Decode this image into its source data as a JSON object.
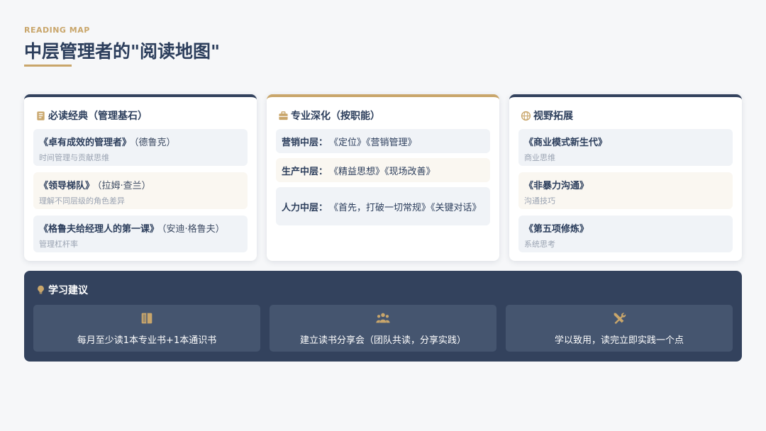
{
  "header": {
    "eyebrow": "READING MAP",
    "title": "中层管理者的\"阅读地图\""
  },
  "cards": [
    {
      "title": "必读经典（管理基石）",
      "icon": "book-icon",
      "items": [
        {
          "book": "《卓有成效的管理者》",
          "author": "（德鲁克）",
          "note": "时间管理与贡献思维"
        },
        {
          "book": "《领导梯队》",
          "author": "（拉姆·查兰）",
          "note": "理解不同层级的角色差异"
        },
        {
          "book": "《格鲁夫给经理人的第一课》",
          "author": "（安迪·格鲁夫）",
          "note": "管理杠杆率"
        }
      ]
    },
    {
      "title": "专业深化（按职能）",
      "icon": "briefcase-icon",
      "items": [
        {
          "role": "营销中层：",
          "books": "《定位》《营销管理》"
        },
        {
          "role": "生产中层：",
          "books": "《精益思想》《现场改善》"
        },
        {
          "role": "人力中层：",
          "books": "《首先，打破一切常规》《关键对话》"
        }
      ]
    },
    {
      "title": "视野拓展",
      "icon": "globe-icon",
      "items": [
        {
          "book": "《商业模式新生代》",
          "note": "商业思维"
        },
        {
          "book": "《非暴力沟通》",
          "note": "沟通技巧"
        },
        {
          "book": "《第五项修炼》",
          "note": "系统思考"
        }
      ]
    }
  ],
  "advice": {
    "title": "学习建议",
    "icon": "lightbulb-icon",
    "tips": [
      {
        "icon": "open-book-icon",
        "text": "每月至少读1本专业书+1本通识书"
      },
      {
        "icon": "team-icon",
        "text": "建立读书分享会（团队共读，分享实践）"
      },
      {
        "icon": "tools-icon",
        "text": "学以致用，读完立即实践一个点"
      }
    ]
  },
  "colors": {
    "navy": "#33425d",
    "gold": "#c9a66b",
    "tip_bg": "#45556f"
  }
}
